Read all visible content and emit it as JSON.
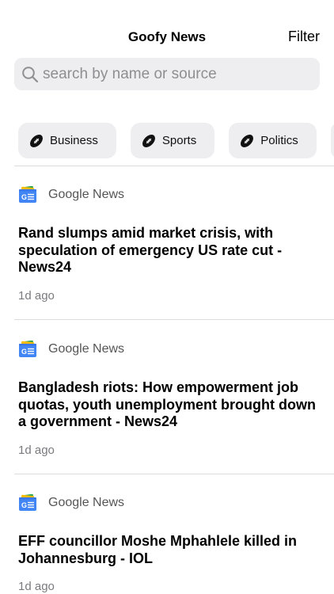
{
  "header": {
    "title": "Goofy News",
    "filter_label": "Filter"
  },
  "search": {
    "placeholder": "search by name or source",
    "icon": "search-icon"
  },
  "categories": [
    {
      "label": "Business",
      "icon": "football-icon"
    },
    {
      "label": "Sports",
      "icon": "football-icon"
    },
    {
      "label": "Politics",
      "icon": "football-icon"
    }
  ],
  "articles": [
    {
      "source": "Google News",
      "source_icon": "google-news-icon",
      "headline": "Rand slumps amid market crisis, with speculation of emergency US rate cut - News24",
      "age": "1d ago"
    },
    {
      "source": "Google News",
      "source_icon": "google-news-icon",
      "headline": "Bangladesh riots: How empowerment job quotas, youth unemployment brought down a government - News24",
      "age": "1d ago"
    },
    {
      "source": "Google News",
      "source_icon": "google-news-icon",
      "headline": "EFF councillor Moshe Mphahlele killed in Johannesburg - IOL",
      "age": "1d ago"
    }
  ],
  "colors": {
    "chip_bg": "#eeeef0",
    "divider": "#dcdcdf",
    "muted_text": "#7a7a7f"
  }
}
